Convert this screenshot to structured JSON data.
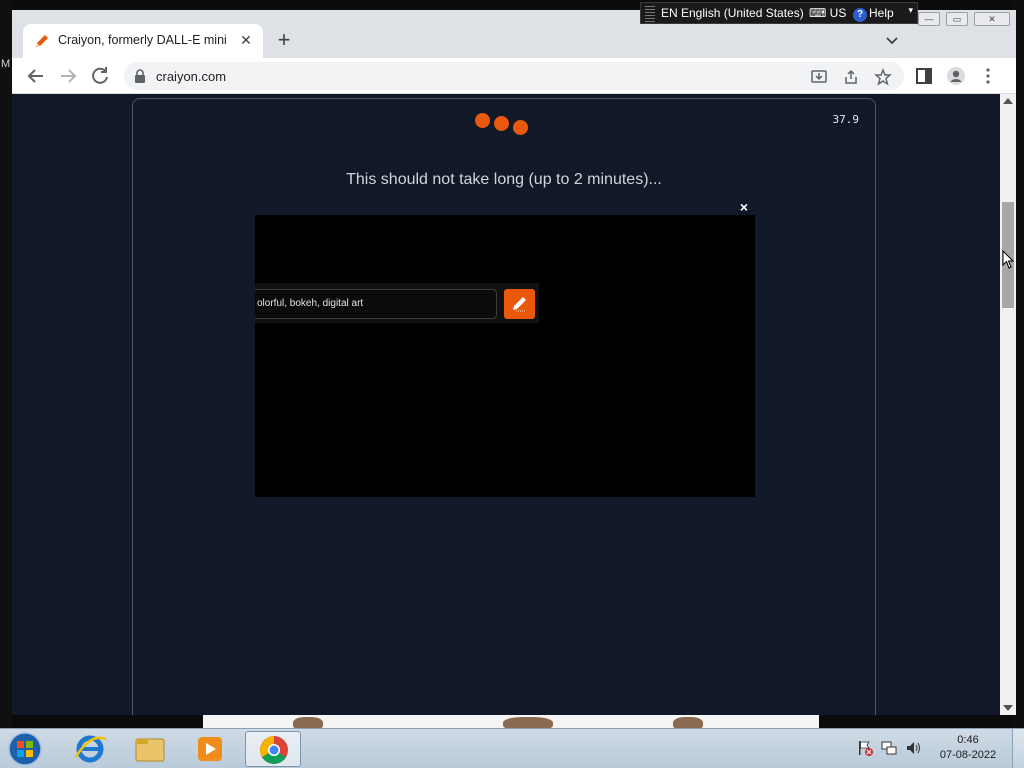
{
  "desktop": {
    "left_char": "M"
  },
  "browser": {
    "tab": {
      "title": "Craiyon, formerly DALL-E mini",
      "close": "✕"
    },
    "newtab": "+",
    "url": "craiyon.com"
  },
  "page": {
    "timer": "37.9",
    "wait_message": "This should not take long (up to 2 minutes)...",
    "ad": {
      "close": "×",
      "prompt_text": "olorful, bokeh, digital art"
    }
  },
  "langbar": {
    "language": "EN English (United States)",
    "keyboard": "US",
    "help": "Help"
  },
  "taskbar": {
    "time": "0:46",
    "date": "07-08-2022"
  },
  "colors": {
    "accent": "#ea580c",
    "page_bg": "#111827"
  }
}
